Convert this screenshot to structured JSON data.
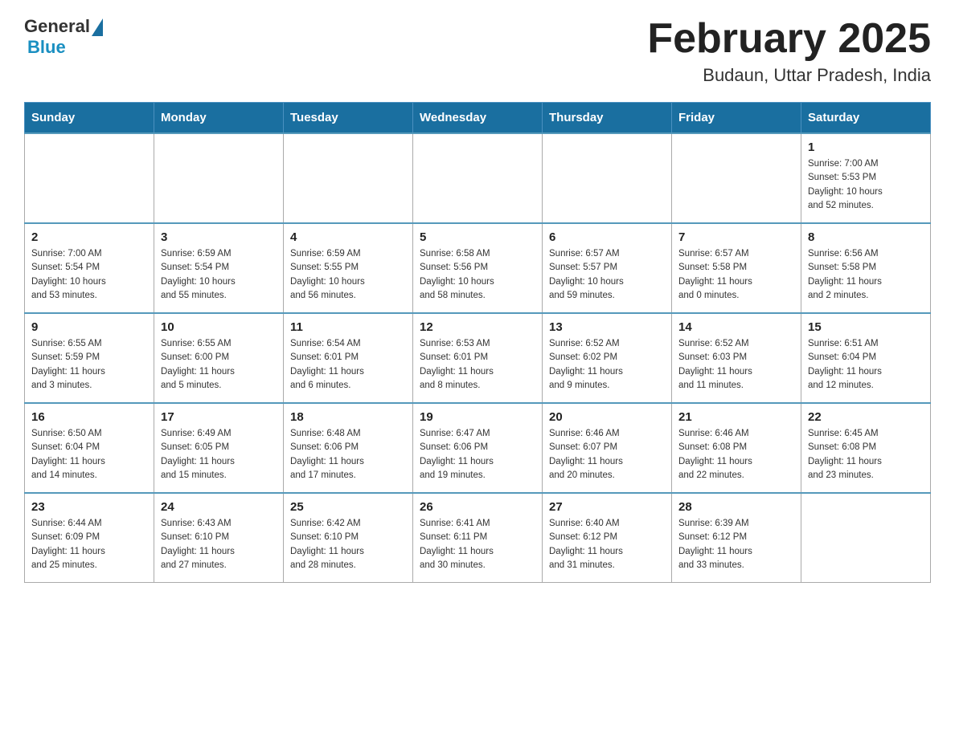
{
  "header": {
    "logo_general": "General",
    "logo_blue": "Blue",
    "month_title": "February 2025",
    "location": "Budaun, Uttar Pradesh, India"
  },
  "weekdays": [
    "Sunday",
    "Monday",
    "Tuesday",
    "Wednesday",
    "Thursday",
    "Friday",
    "Saturday"
  ],
  "weeks": [
    [
      {
        "day": "",
        "info": ""
      },
      {
        "day": "",
        "info": ""
      },
      {
        "day": "",
        "info": ""
      },
      {
        "day": "",
        "info": ""
      },
      {
        "day": "",
        "info": ""
      },
      {
        "day": "",
        "info": ""
      },
      {
        "day": "1",
        "info": "Sunrise: 7:00 AM\nSunset: 5:53 PM\nDaylight: 10 hours\nand 52 minutes."
      }
    ],
    [
      {
        "day": "2",
        "info": "Sunrise: 7:00 AM\nSunset: 5:54 PM\nDaylight: 10 hours\nand 53 minutes."
      },
      {
        "day": "3",
        "info": "Sunrise: 6:59 AM\nSunset: 5:54 PM\nDaylight: 10 hours\nand 55 minutes."
      },
      {
        "day": "4",
        "info": "Sunrise: 6:59 AM\nSunset: 5:55 PM\nDaylight: 10 hours\nand 56 minutes."
      },
      {
        "day": "5",
        "info": "Sunrise: 6:58 AM\nSunset: 5:56 PM\nDaylight: 10 hours\nand 58 minutes."
      },
      {
        "day": "6",
        "info": "Sunrise: 6:57 AM\nSunset: 5:57 PM\nDaylight: 10 hours\nand 59 minutes."
      },
      {
        "day": "7",
        "info": "Sunrise: 6:57 AM\nSunset: 5:58 PM\nDaylight: 11 hours\nand 0 minutes."
      },
      {
        "day": "8",
        "info": "Sunrise: 6:56 AM\nSunset: 5:58 PM\nDaylight: 11 hours\nand 2 minutes."
      }
    ],
    [
      {
        "day": "9",
        "info": "Sunrise: 6:55 AM\nSunset: 5:59 PM\nDaylight: 11 hours\nand 3 minutes."
      },
      {
        "day": "10",
        "info": "Sunrise: 6:55 AM\nSunset: 6:00 PM\nDaylight: 11 hours\nand 5 minutes."
      },
      {
        "day": "11",
        "info": "Sunrise: 6:54 AM\nSunset: 6:01 PM\nDaylight: 11 hours\nand 6 minutes."
      },
      {
        "day": "12",
        "info": "Sunrise: 6:53 AM\nSunset: 6:01 PM\nDaylight: 11 hours\nand 8 minutes."
      },
      {
        "day": "13",
        "info": "Sunrise: 6:52 AM\nSunset: 6:02 PM\nDaylight: 11 hours\nand 9 minutes."
      },
      {
        "day": "14",
        "info": "Sunrise: 6:52 AM\nSunset: 6:03 PM\nDaylight: 11 hours\nand 11 minutes."
      },
      {
        "day": "15",
        "info": "Sunrise: 6:51 AM\nSunset: 6:04 PM\nDaylight: 11 hours\nand 12 minutes."
      }
    ],
    [
      {
        "day": "16",
        "info": "Sunrise: 6:50 AM\nSunset: 6:04 PM\nDaylight: 11 hours\nand 14 minutes."
      },
      {
        "day": "17",
        "info": "Sunrise: 6:49 AM\nSunset: 6:05 PM\nDaylight: 11 hours\nand 15 minutes."
      },
      {
        "day": "18",
        "info": "Sunrise: 6:48 AM\nSunset: 6:06 PM\nDaylight: 11 hours\nand 17 minutes."
      },
      {
        "day": "19",
        "info": "Sunrise: 6:47 AM\nSunset: 6:06 PM\nDaylight: 11 hours\nand 19 minutes."
      },
      {
        "day": "20",
        "info": "Sunrise: 6:46 AM\nSunset: 6:07 PM\nDaylight: 11 hours\nand 20 minutes."
      },
      {
        "day": "21",
        "info": "Sunrise: 6:46 AM\nSunset: 6:08 PM\nDaylight: 11 hours\nand 22 minutes."
      },
      {
        "day": "22",
        "info": "Sunrise: 6:45 AM\nSunset: 6:08 PM\nDaylight: 11 hours\nand 23 minutes."
      }
    ],
    [
      {
        "day": "23",
        "info": "Sunrise: 6:44 AM\nSunset: 6:09 PM\nDaylight: 11 hours\nand 25 minutes."
      },
      {
        "day": "24",
        "info": "Sunrise: 6:43 AM\nSunset: 6:10 PM\nDaylight: 11 hours\nand 27 minutes."
      },
      {
        "day": "25",
        "info": "Sunrise: 6:42 AM\nSunset: 6:10 PM\nDaylight: 11 hours\nand 28 minutes."
      },
      {
        "day": "26",
        "info": "Sunrise: 6:41 AM\nSunset: 6:11 PM\nDaylight: 11 hours\nand 30 minutes."
      },
      {
        "day": "27",
        "info": "Sunrise: 6:40 AM\nSunset: 6:12 PM\nDaylight: 11 hours\nand 31 minutes."
      },
      {
        "day": "28",
        "info": "Sunrise: 6:39 AM\nSunset: 6:12 PM\nDaylight: 11 hours\nand 33 minutes."
      },
      {
        "day": "",
        "info": ""
      }
    ]
  ]
}
